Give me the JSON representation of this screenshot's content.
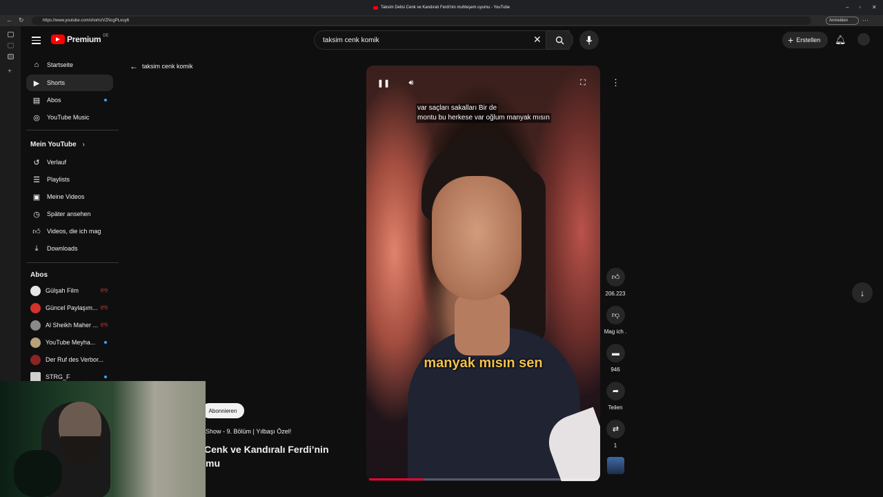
{
  "browser": {
    "tab_title": "Taksim Delisi Cenk ve Kandıralı Ferdi'nin muhteşem uyumu - YouTube",
    "url": "https://www.youtube.com/shorts/VZNcgPLouy6",
    "profile_label": "Anmelden"
  },
  "header": {
    "logo_text": "Premium",
    "logo_region": "DE",
    "search_value": "taksim cenk komik",
    "create_label": "Erstellen"
  },
  "sidebar": {
    "main": [
      {
        "label": "Startseite",
        "icon": "home-icon"
      },
      {
        "label": "Shorts",
        "icon": "shorts-icon"
      },
      {
        "label": "Abos",
        "icon": "subscriptions-icon"
      },
      {
        "label": "YouTube Music",
        "icon": "music-icon"
      }
    ],
    "you_heading": "Mein YouTube",
    "you": [
      {
        "label": "Verlauf",
        "icon": "history-icon"
      },
      {
        "label": "Playlists",
        "icon": "playlists-icon"
      },
      {
        "label": "Meine Videos",
        "icon": "my-videos-icon"
      },
      {
        "label": "Später ansehen",
        "icon": "watch-later-icon"
      },
      {
        "label": "Videos, die ich mag",
        "icon": "liked-icon"
      },
      {
        "label": "Downloads",
        "icon": "download-icon"
      }
    ],
    "subs_heading": "Abos",
    "subs": [
      {
        "label": "Gülşah Film"
      },
      {
        "label": "Güncel Paylaşım..."
      },
      {
        "label": "Al Sheikh Maher ..."
      },
      {
        "label": "YouTube Meyha..."
      },
      {
        "label": "Der Ruf des Verbor..."
      },
      {
        "label": "STRG_F"
      }
    ]
  },
  "back_search_label": "taksim cenk komik",
  "player": {
    "caption_line1": "var saçları sakalları Bir de",
    "caption_line2": "montu bu herkese var oğlum manyak mısın",
    "burned_caption": "manyak mısın sen",
    "progress": 0.24
  },
  "actions": {
    "likes": "206.223",
    "dislike_label": "Mag ich .",
    "comments": "946",
    "share_label": "Teilen",
    "remix_count": "1"
  },
  "video_meta": {
    "subscribe_label": "Abonnieren",
    "show_line": "Show - 9. Bölüm | Yılbaşı Özel!",
    "title_line1": "Cenk ve Kandıralı Ferdi’nin",
    "title_line2": "mu"
  },
  "colors": {
    "accent": "#ff0000",
    "background": "#0f0f0f",
    "caption_yellow": "#f2c14e"
  }
}
